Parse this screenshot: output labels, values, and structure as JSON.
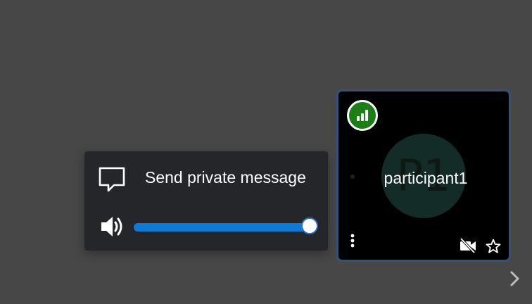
{
  "popup": {
    "send_private_message_label": "Send private message",
    "volume_icon": "volume-icon",
    "message_icon": "chat-bubble-icon",
    "volume_level": 1.0
  },
  "tile": {
    "participant_name": "participant1",
    "avatar_initials": "P1",
    "connection_icon": "signal-bars-icon",
    "menu_icon": "more-vertical-icon",
    "video_status_icon": "video-off-icon",
    "pin_icon": "star-outline-icon"
  },
  "navigation": {
    "next_icon": "chevron-right-icon"
  },
  "colors": {
    "background": "#474747",
    "popup_bg": "#25262a",
    "slider_fill": "#0d7ad6",
    "tile_border": "#31527c",
    "connection_good": "#1b7f16",
    "avatar_bg": "#132c27"
  }
}
